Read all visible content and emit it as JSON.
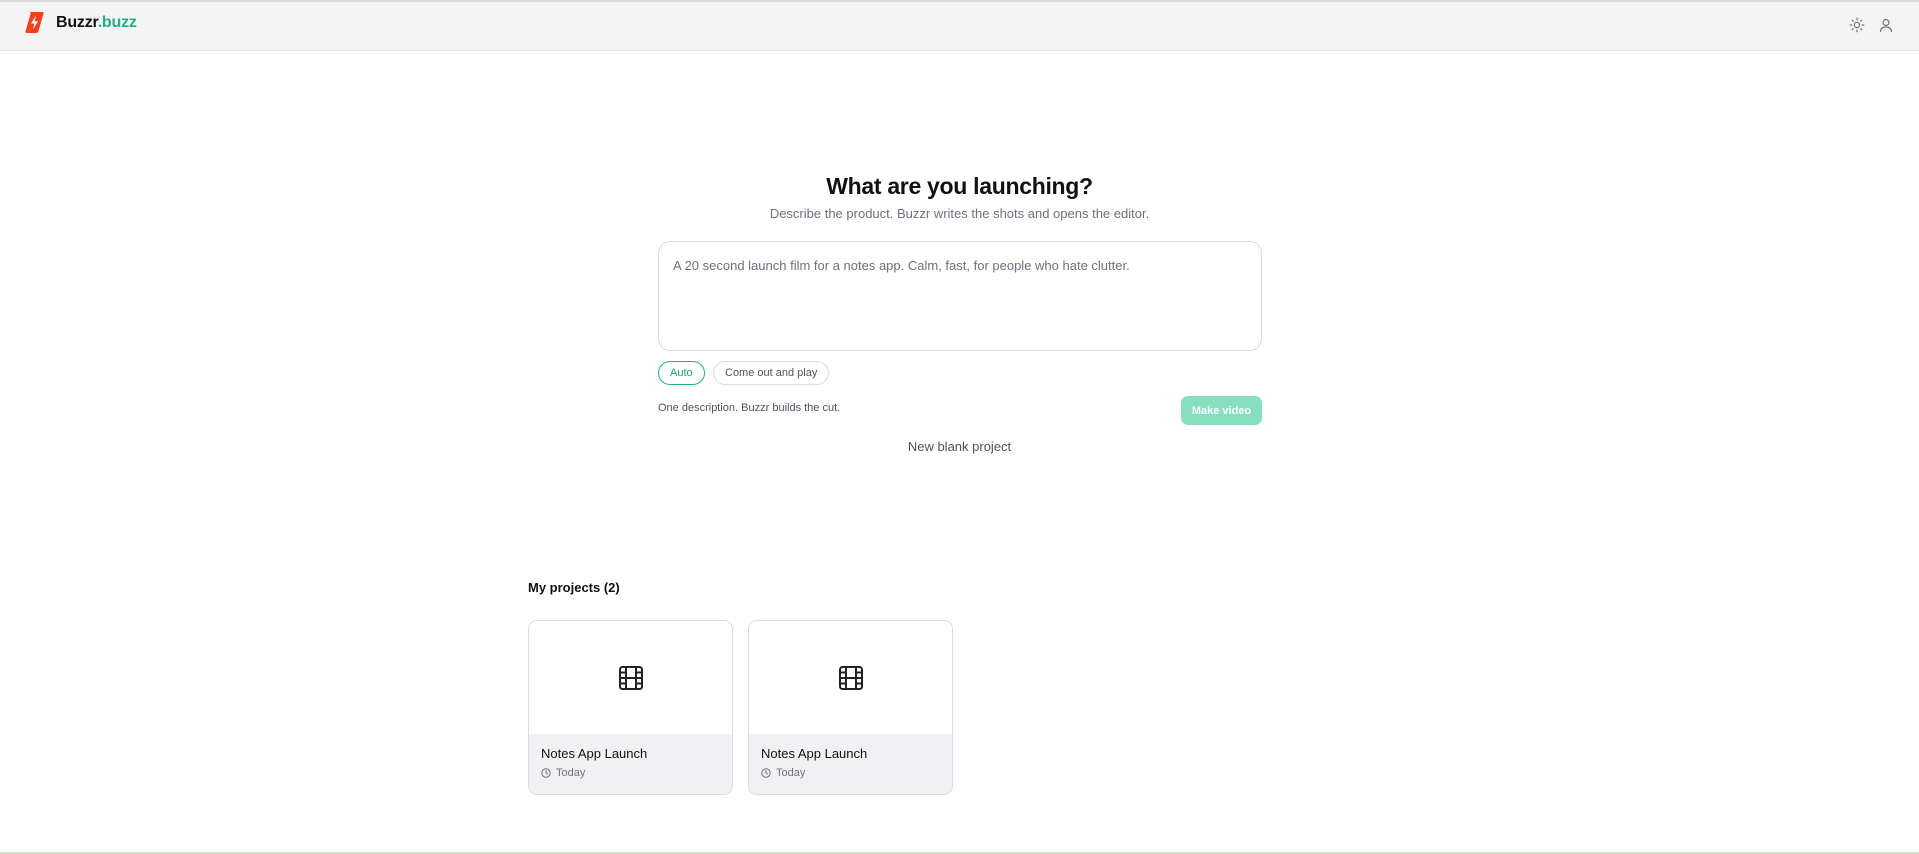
{
  "header": {
    "brand_name": "Buzzr",
    "brand_suffix": ".buzz",
    "logo_icon": "lightning-bolt-icon",
    "theme_toggle_icon": "sun-icon",
    "account_icon": "user-icon"
  },
  "hero": {
    "title": "What are you launching?",
    "subtitle": "Describe the product. Buzzr writes the shots and opens the editor."
  },
  "prompt": {
    "placeholder": "A 20 second launch film for a notes app. Calm, fast, for people who hate clutter."
  },
  "styles": [
    {
      "label": "Auto",
      "selected": true
    },
    {
      "label": "Come out and play",
      "selected": false
    }
  ],
  "helper_text": "One description. Buzzr builds the cut.",
  "make_video_label": "Make video",
  "new_blank_label": "New blank project",
  "projects": {
    "title": "My projects (2)",
    "items": [
      {
        "name": "Notes App Launch",
        "updated": "Today",
        "thumb_icon": "film-icon"
      },
      {
        "name": "Notes App Launch",
        "updated": "Today",
        "thumb_icon": "film-icon"
      }
    ]
  },
  "colors": {
    "accent": "#22b07d",
    "brand_logo": "#f0411e",
    "button_disabled": "#86dfbf",
    "header_bg": "#f4f4f5"
  }
}
